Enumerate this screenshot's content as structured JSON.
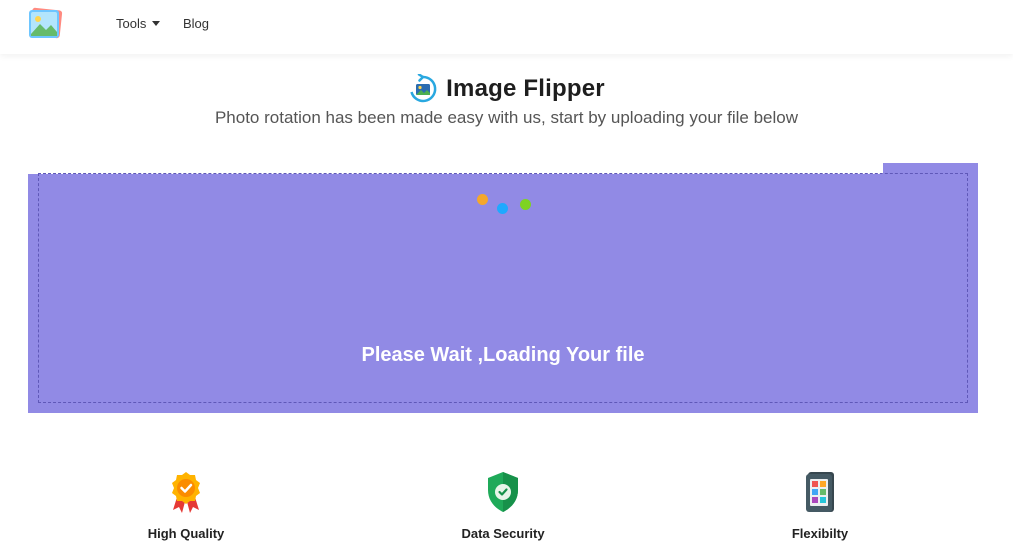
{
  "nav": {
    "tools_label": "Tools",
    "blog_label": "Blog"
  },
  "header": {
    "title": "Image Flipper",
    "subtitle": "Photo rotation has been made easy with us, start by uploading your file below"
  },
  "upload": {
    "loading_text": "Please Wait ,Loading Your file",
    "background_color": "#918ae5",
    "loader_dot_colors": [
      "#f4a72c",
      "#1ea9ff",
      "#7ed321"
    ]
  },
  "features": [
    {
      "label": "High Quality",
      "icon": "award-medal-icon"
    },
    {
      "label": "Data Security",
      "icon": "shield-check-icon"
    },
    {
      "label": "Flexibilty",
      "icon": "phone-apps-icon"
    }
  ]
}
